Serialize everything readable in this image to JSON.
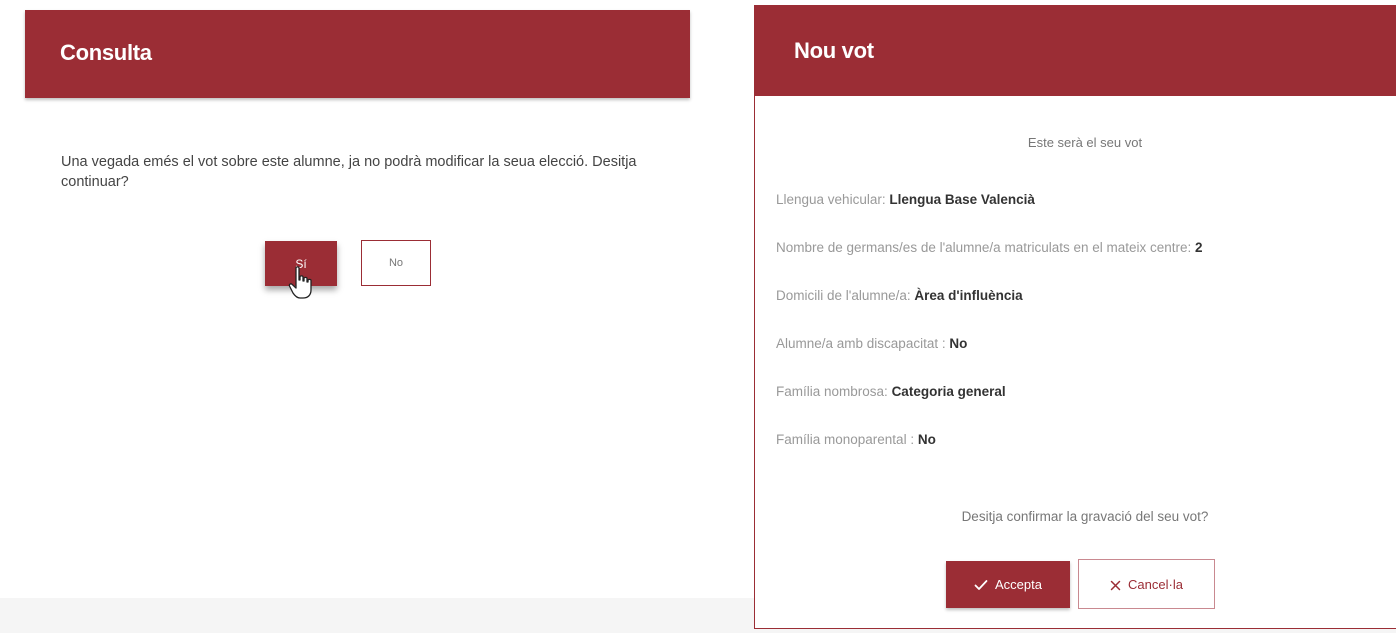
{
  "colors": {
    "accent": "#9b2d35",
    "text_muted": "#999999",
    "text_strong": "#333333"
  },
  "consulta": {
    "title": "Consulta",
    "message": "Una vegada emés el vot sobre este alumne, ja no podrà modificar la seua elecció. Desitja continuar?",
    "yes_label": "Sí",
    "no_label": "No"
  },
  "nou_vot": {
    "title": "Nou vot",
    "intro": "Este serà el seu vot",
    "fields": [
      {
        "label": "Llengua vehicular:",
        "value": "Llengua Base Valencià"
      },
      {
        "label": "Nombre de germans/es de l'alumne/a matriculats en el mateix centre:",
        "value": "2"
      },
      {
        "label": "Domicili de l'alumne/a:",
        "value": "Àrea d'influència"
      },
      {
        "label": "Alumne/a amb discapacitat :",
        "value": "No"
      },
      {
        "label": "Família nombrosa:",
        "value": "Categoria general"
      },
      {
        "label": "Família monoparental :",
        "value": "No"
      }
    ],
    "question": "Desitja confirmar la gravació del seu vot?",
    "accept_label": "Accepta",
    "accept_icon": "check-icon",
    "cancel_label": "Cancel·la",
    "cancel_icon": "close-icon"
  }
}
